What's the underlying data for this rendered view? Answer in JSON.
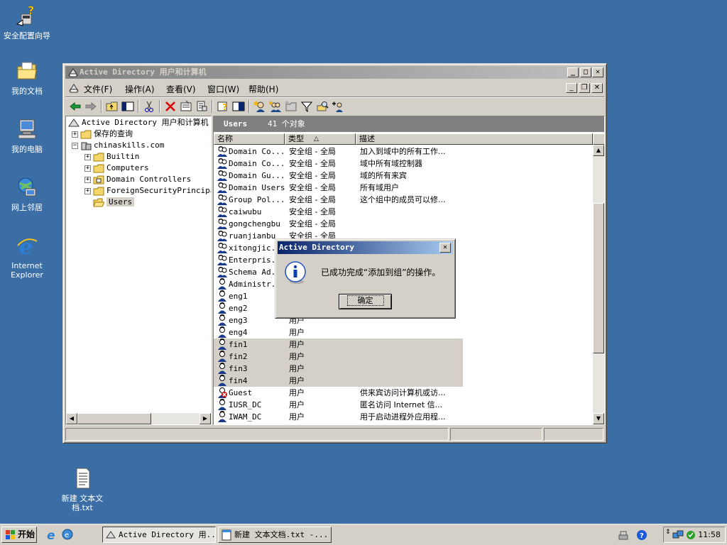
{
  "desktop": {
    "icons": [
      {
        "label": "安全配置向导",
        "icon": "security-wizard-icon"
      },
      {
        "label": "我的文档",
        "icon": "my-documents-icon"
      },
      {
        "label": "我的电脑",
        "icon": "my-computer-icon"
      },
      {
        "label": "网上邻居",
        "icon": "network-places-icon"
      },
      {
        "label": "Internet Explorer",
        "icon": "internet-explorer-icon"
      },
      {
        "label": "新建 文本文档.txt",
        "icon": "text-file-icon"
      }
    ]
  },
  "window": {
    "title": "Active Directory 用户和计算机",
    "menu": [
      "文件(F)",
      "操作(A)",
      "查看(V)",
      "窗口(W)",
      "帮助(H)"
    ]
  },
  "tree": {
    "root": "Active Directory 用户和计算机",
    "saved_queries": "保存的查询",
    "domain": "chinaskills.com",
    "children": [
      "Builtin",
      "Computers",
      "Domain Controllers",
      "ForeignSecurityPrincipa",
      "Users"
    ]
  },
  "list": {
    "header_title": "Users",
    "header_count": "41 个对象",
    "columns": [
      "名称",
      "类型",
      "描述"
    ],
    "rows": [
      {
        "name": "Domain Co...",
        "type": "安全组 - 全局",
        "desc": "加入到域中的所有工作..."
      },
      {
        "name": "Domain Co...",
        "type": "安全组 - 全局",
        "desc": "域中所有域控制器"
      },
      {
        "name": "Domain Gu...",
        "type": "安全组 - 全局",
        "desc": "域的所有来宾"
      },
      {
        "name": "Domain Users",
        "type": "安全组 - 全局",
        "desc": "所有域用户"
      },
      {
        "name": "Group Pol...",
        "type": "安全组 - 全局",
        "desc": "这个组中的成员可以修..."
      },
      {
        "name": "caiwubu",
        "type": "安全组 - 全局",
        "desc": ""
      },
      {
        "name": "gongchengbu",
        "type": "安全组 - 全局",
        "desc": ""
      },
      {
        "name": "ruanjianbu",
        "type": "安全组 - 全局",
        "desc": ""
      },
      {
        "name": "xitongjic...",
        "type": "",
        "desc": ""
      },
      {
        "name": "Enterpris...",
        "type": "",
        "desc": ""
      },
      {
        "name": "Schema Ad...",
        "type": "",
        "desc": ""
      },
      {
        "name": "Administr...",
        "type": "",
        "desc": ""
      },
      {
        "name": "eng1",
        "type": "",
        "desc": ""
      },
      {
        "name": "eng2",
        "type": "",
        "desc": ""
      },
      {
        "name": "eng3",
        "type": "用户",
        "desc": ""
      },
      {
        "name": "eng4",
        "type": "用户",
        "desc": ""
      },
      {
        "name": "fin1",
        "type": "用户",
        "desc": ""
      },
      {
        "name": "fin2",
        "type": "用户",
        "desc": ""
      },
      {
        "name": "fin3",
        "type": "用户",
        "desc": ""
      },
      {
        "name": "fin4",
        "type": "用户",
        "desc": ""
      },
      {
        "name": "Guest",
        "type": "用户",
        "desc": "供来宾访问计算机或访..."
      },
      {
        "name": "IUSR_DC",
        "type": "用户",
        "desc": "匿名访问 Internet 信..."
      },
      {
        "name": "IWAM_DC",
        "type": "用户",
        "desc": "用于启动进程外应用程..."
      }
    ]
  },
  "dialog": {
    "title": "Active Directory",
    "message": "已成功完成“添加到组”的操作。",
    "ok_label": "确定"
  },
  "taskbar": {
    "start_label": "开始",
    "tasks": [
      "Active Directory 用...",
      "新建 文本文档.txt -..."
    ],
    "clock": "11:58"
  }
}
